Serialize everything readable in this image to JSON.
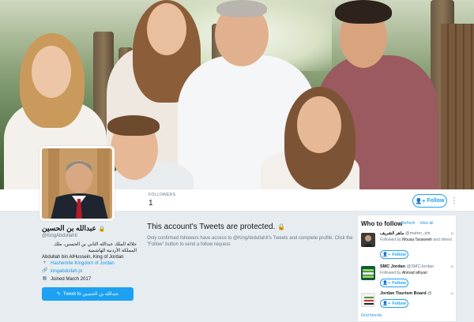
{
  "profile": {
    "name": "عبدالله بن الحسين",
    "handle": "@KingAbdullahII",
    "bio_ar": "جلالة الملك عبدالله الثاني بن الحسين، ملك المملكة الأردنية الهاشمية",
    "bio_en": "Abdullah bin AlHussein, King of Jordan",
    "location": "Hashemite Kingdom of Jordan",
    "website": "kingabdullah.jo",
    "joined": "Joined March 2017",
    "tweet_button": "Tweet to عبدالله بن الحسين"
  },
  "stats": {
    "label": "FOLLOWERS",
    "value": "1"
  },
  "actions": {
    "follow_label": "Follow"
  },
  "protected": {
    "title": "This account's Tweets are protected.",
    "text": "Only confirmed followers have access to @KingAbdullahII's Tweets and complete profile. Click the \"Follow\" button to send a follow request."
  },
  "who_to_follow": {
    "title": "Who to follow",
    "refresh": "Refresh",
    "sep": "·",
    "view_all": "View all",
    "items": [
      {
        "name": "ماهر الشريف",
        "handle": "@maher_shr",
        "followed_prefix": "Followed by",
        "followed_names": "Mousa Tarawneh",
        "followed_suffix": "and others",
        "follow": "Follow"
      },
      {
        "name": "SMC Jordan",
        "handle": "@SMCJordan",
        "followed_prefix": "Followed by",
        "followed_names": "Ahmad alhyari",
        "followed_suffix": "",
        "follow": "Follow"
      },
      {
        "name": "Jordan Tourism Board",
        "handle": "@",
        "followed_prefix": "",
        "followed_names": "",
        "followed_suffix": "",
        "follow": "Follow"
      }
    ],
    "find_people": "Find friends"
  },
  "icons": {
    "lock": "lock-icon",
    "location": "location-pin-icon",
    "link": "link-icon",
    "calendar": "calendar-icon",
    "add_user": "add-user-icon",
    "more": "more-vertical-icon",
    "close": "close-icon"
  },
  "colors": {
    "accent": "#1da1f2",
    "link": "#1b95e0",
    "muted": "#657786",
    "background": "#e6ecf0"
  }
}
